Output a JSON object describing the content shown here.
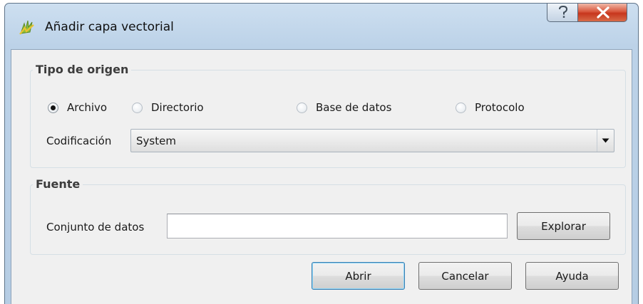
{
  "window": {
    "title": "Añadir capa vectorial",
    "app_icon": "qgis-icon",
    "help_icon": "question-mark-icon",
    "close_icon": "close-x-icon"
  },
  "source_type": {
    "legend": "Tipo de origen",
    "options": [
      {
        "label": "Archivo",
        "selected": true
      },
      {
        "label": "Directorio",
        "selected": false
      },
      {
        "label": "Base de datos",
        "selected": false
      },
      {
        "label": "Protocolo",
        "selected": false
      }
    ],
    "encoding_label": "Codificación",
    "encoding_value": "System"
  },
  "source": {
    "legend": "Fuente",
    "dataset_label": "Conjunto de datos",
    "dataset_value": "",
    "browse_label": "Explorar"
  },
  "actions": {
    "open_label": "Abrir",
    "cancel_label": "Cancelar",
    "help_label": "Ayuda"
  },
  "colors": {
    "title_bar": "#bcd2e8",
    "close_button": "#c7361d",
    "dialog_bg": "#f0f0f0",
    "default_button_border": "#3c7fb1"
  }
}
